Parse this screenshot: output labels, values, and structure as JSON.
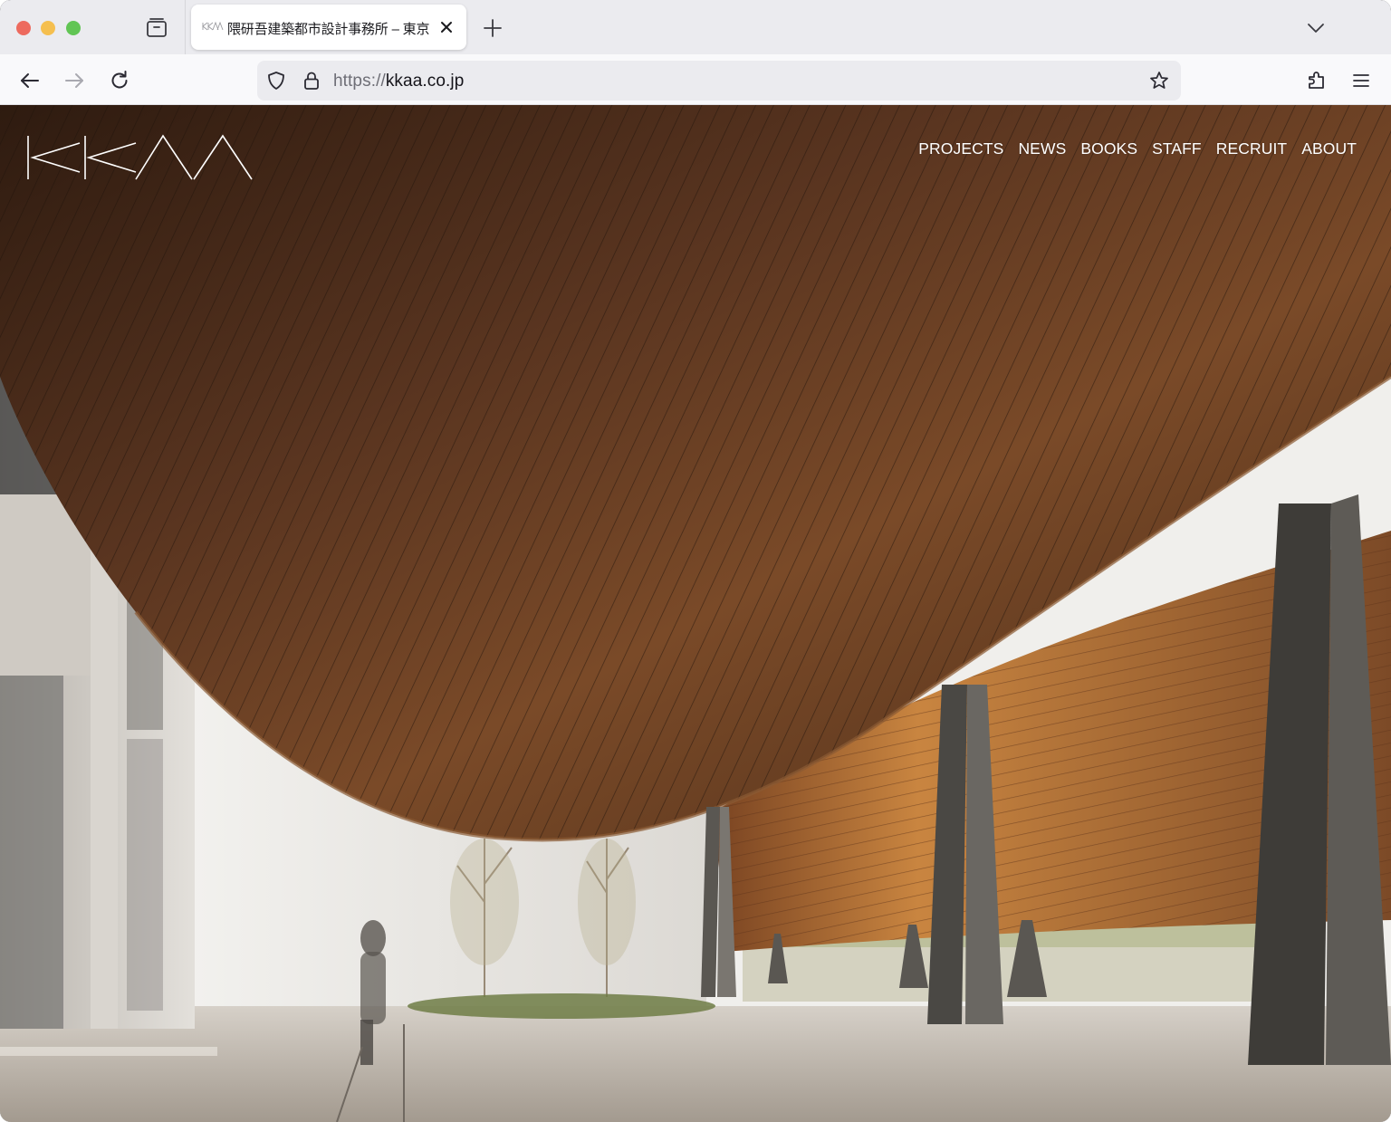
{
  "browser": {
    "tab": {
      "title": "隈研吾建築都市設計事務所 – 東京",
      "favicon": "kkaa-logo-icon"
    },
    "urlbar": {
      "scheme": "https://",
      "host": "kkaa.co.jp"
    },
    "colors": {
      "tabstrip_bg": "#ebebef",
      "toolbar_bg": "#f9f9fb",
      "urlbar_bg": "#ebebef",
      "close": "#ed6a5e",
      "minimize": "#f5bf4f",
      "zoom": "#61c554"
    },
    "icons": [
      "tab-overview-icon",
      "close-icon",
      "plus-icon",
      "chevron-down-icon",
      "back-arrow-icon",
      "forward-arrow-icon",
      "reload-icon",
      "shield-icon",
      "lock-icon",
      "star-icon",
      "extensions-icon",
      "hamburger-menu-icon"
    ]
  },
  "site": {
    "logo_text": "KKAA",
    "nav": [
      "PROJECTS",
      "NEWS",
      "BOOKS",
      "STAFF",
      "RECRUIT",
      "ABOUT"
    ],
    "hero": {
      "description": "Photograph of a curved timber-slat canopy supported by tapered dark columns over a paved courtyard with young trees and a walking figure",
      "colors": {
        "wood_dark": "#3b2416",
        "wood_mid": "#6e4326",
        "wood_warm": "#b06d33",
        "wall": "#e8e6e2",
        "ground": "#bfb7ad",
        "column": "#4a4844"
      }
    }
  }
}
